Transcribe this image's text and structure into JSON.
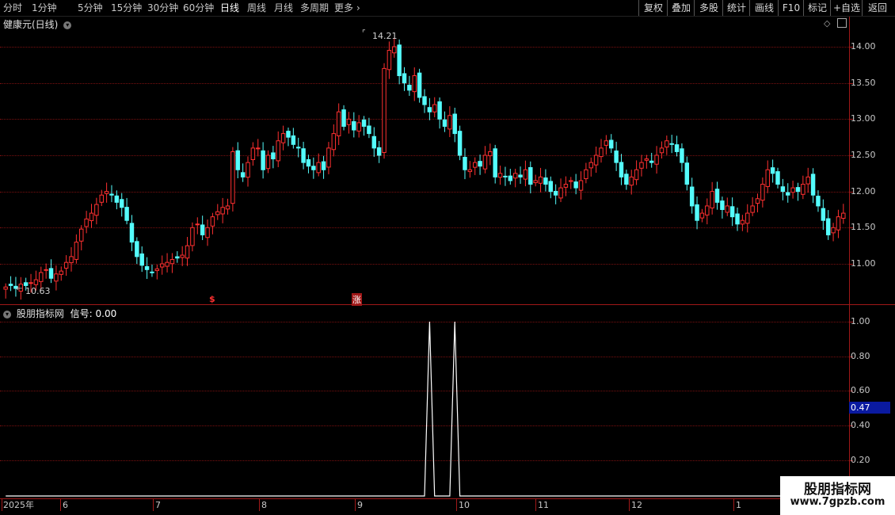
{
  "toolbar": {
    "periods": [
      "分时",
      "1分钟",
      "5分钟",
      "15分钟",
      "30分钟",
      "60分钟",
      "日线",
      "周线",
      "月线",
      "多周期",
      "更多"
    ],
    "active_period": "日线",
    "right_buttons": [
      "复权",
      "叠加",
      "多股",
      "统计",
      "画线",
      "F10",
      "标记",
      "+自选",
      "返回"
    ]
  },
  "main": {
    "title": "健康元(日线)",
    "y_ticks": [
      "14.00",
      "13.50",
      "13.00",
      "12.50",
      "12.00",
      "11.50",
      "11.00"
    ],
    "high_label": "14.21",
    "low_label": "10.63",
    "markers": [
      "$",
      "涨"
    ]
  },
  "indicator": {
    "title": "股朋指标网",
    "signal_label": "信号:",
    "signal_value": "0.00",
    "y_ticks": [
      "1.00",
      "0.80",
      "0.60",
      "0.40",
      "0.20"
    ],
    "cursor_value": "0.47"
  },
  "x_axis": {
    "labels": [
      "2025年",
      "6",
      "7",
      "8",
      "9",
      "10",
      "11",
      "12",
      "1"
    ]
  },
  "watermark": {
    "line1": "股朋指标网",
    "line2": "www.7gpzb.com"
  },
  "colors": {
    "up": "#ff3030",
    "down": "#54fcfc",
    "axis": "#a01818",
    "signal": "#ffffff"
  },
  "chart_data": {
    "type": "candlestick",
    "ohlc_close_series": [
      10.68,
      10.7,
      10.66,
      10.72,
      10.7,
      10.74,
      10.78,
      10.88,
      10.92,
      10.8,
      10.86,
      10.9,
      11.02,
      11.1,
      11.3,
      11.48,
      11.62,
      11.7,
      11.82,
      11.95,
      12.0,
      11.95,
      11.85,
      11.78,
      11.6,
      11.3,
      11.1,
      10.98,
      10.92,
      10.88,
      10.93,
      11.0,
      11.02,
      11.06,
      11.08,
      11.12,
      11.25,
      11.5,
      11.55,
      11.4,
      11.5,
      11.65,
      11.72,
      11.78,
      11.8,
      12.55,
      12.3,
      12.2,
      12.4,
      12.6,
      12.6,
      12.3,
      12.5,
      12.45,
      12.7,
      12.8,
      12.75,
      12.65,
      12.6,
      12.4,
      12.35,
      12.3,
      12.4,
      12.3,
      12.6,
      12.8,
      13.1,
      12.9,
      13.0,
      12.85,
      12.95,
      12.9,
      12.8,
      12.6,
      12.5,
      13.7,
      13.95,
      14.0,
      13.6,
      13.5,
      13.4,
      13.6,
      13.3,
      13.2,
      13.1,
      13.2,
      13.0,
      12.9,
      13.05,
      12.8,
      12.5,
      12.3,
      12.3,
      12.4,
      12.35,
      12.5,
      12.55,
      12.2,
      12.25,
      12.2,
      12.15,
      12.25,
      12.2,
      12.3,
      12.1,
      12.15,
      12.2,
      12.1,
      12.0,
      11.95,
      12.05,
      12.1,
      12.15,
      12.05,
      12.15,
      12.3,
      12.4,
      12.5,
      12.6,
      12.7,
      12.6,
      12.4,
      12.2,
      12.1,
      12.2,
      12.3,
      12.4,
      12.45,
      12.4,
      12.5,
      12.6,
      12.7,
      12.65,
      12.55,
      12.4,
      12.1,
      11.8,
      11.6,
      11.7,
      11.8,
      12.0,
      11.85,
      11.75,
      11.8,
      11.65,
      11.55,
      11.6,
      11.7,
      11.8,
      11.9,
      12.1,
      12.3,
      12.25,
      12.1,
      12.0,
      11.95,
      12.05,
      12.0,
      12.1,
      12.2,
      11.95,
      11.8,
      11.6,
      11.4,
      11.5,
      11.65,
      11.7
    ],
    "y_range": [
      10.5,
      14.5
    ],
    "signal": {
      "name": "信号",
      "spikes_at_index": [
        84,
        89
      ],
      "range": [
        0,
        1
      ]
    }
  }
}
